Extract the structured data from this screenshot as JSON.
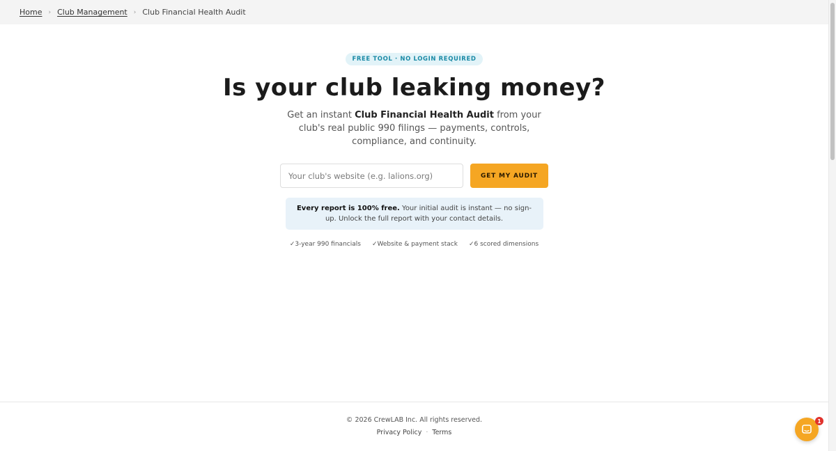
{
  "breadcrumb": {
    "items": [
      {
        "label": "Home"
      },
      {
        "label": "Club Management"
      }
    ],
    "separator": "›",
    "current": "Club Financial Health Audit"
  },
  "hero": {
    "pill": "FREE TOOL · NO LOGIN REQUIRED",
    "headline": "Is your club leaking money?",
    "subhead_pre": "Get an instant ",
    "subhead_bold": "Club Financial Health Audit",
    "subhead_post": " from your club's real public 990 filings — payments, controls, compliance, and continuity."
  },
  "form": {
    "input_placeholder": "Your club's website (e.g. lalions.org)",
    "input_value": "",
    "button_label": "GET MY AUDIT"
  },
  "notice": {
    "bold": "Every report is 100% free.",
    "text": " Your initial audit is instant — no sign-up. Unlock the full report with your contact details."
  },
  "features": [
    "✓3-year 990 financials",
    "✓Website & payment stack",
    "✓6 scored dimensions"
  ],
  "footer": {
    "copyright": "© 2026 CrewLAB Inc. All rights reserved.",
    "privacy": "Privacy Policy",
    "dot": "·",
    "terms": "Terms"
  },
  "chat": {
    "icon": "chat-icon",
    "badge_count": "1"
  },
  "colors": {
    "accent": "#f5a623",
    "pill_bg": "#e2f3f8",
    "pill_text": "#1a8aa6",
    "notice_bg": "#e8f2f9",
    "badge": "#e0322c"
  }
}
